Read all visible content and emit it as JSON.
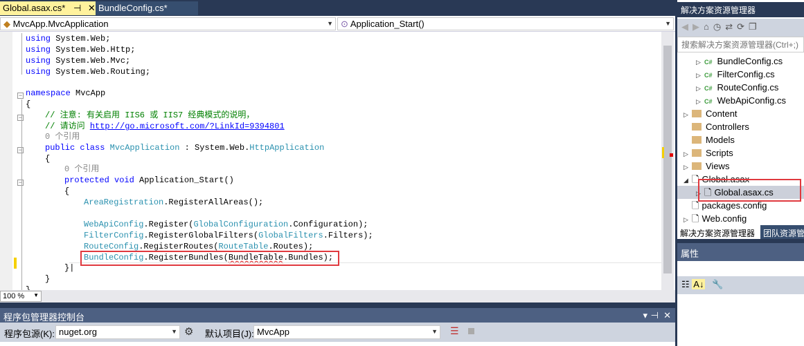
{
  "tabs": [
    {
      "label": "Global.asax.cs*",
      "active": true
    },
    {
      "label": "BundleConfig.cs*",
      "active": false
    }
  ],
  "navbar": {
    "class_combo": "MvcApp.MvcApplication",
    "member_combo": "Application_Start()"
  },
  "code": {
    "l1": "System.Web;",
    "l2": "System.Web.Http;",
    "l3": "System.Web.Mvc;",
    "l4": "System.Web.Routing;",
    "using": "using",
    "namespace_kw": "namespace",
    "namespace_name": " MvcApp",
    "brace_open": "{",
    "brace_close": "}",
    "comment1": "// 注意: 有关启用 IIS6 或 IIS7 经典模式的说明，",
    "comment2_prefix": "// 请访问 ",
    "comment2_link": "http://go.microsoft.com/?LinkId=9394801",
    "refs": "0 个引用",
    "public_class": "public class ",
    "class_name": "MvcApplication",
    "colon": " : System.Web.",
    "base": "HttpApplication",
    "protected_void": "protected void ",
    "method": "Application_Start()",
    "area_t": "AreaRegistration",
    "area_m": ".RegisterAllAreas();",
    "webapi_t": "WebApiConfig",
    "webapi_m": ".Register(",
    "gc_t": "GlobalConfiguration",
    "gc_m": ".Configuration);",
    "filter_t": "FilterConfig",
    "filter_m": ".RegisterGlobalFilters(",
    "gf_t": "GlobalFilters",
    "gf_m": ".Filters);",
    "route_t": "RouteConfig",
    "route_m": ".RegisterRoutes(",
    "rt_t": "RouteTable",
    "rt_m": ".Routes);",
    "bundle_t": "BundleConfig",
    "bundle_m": ".RegisterBundles(",
    "bt_t": "BundleTable",
    "bt_m": ".Bundles);"
  },
  "zoom": "100 %",
  "console": {
    "title": "程序包管理器控制台",
    "source_label": "程序包源(K):",
    "source_value": "nuget.org",
    "project_label": "默认项目(J):",
    "project_value": "MvcApp"
  },
  "solution_explorer": {
    "title": "解决方案资源管理器",
    "search_placeholder": "搜索解决方案资源管理器(Ctrl+;)",
    "items": [
      {
        "label": "BundleConfig.cs",
        "type": "cs"
      },
      {
        "label": "FilterConfig.cs",
        "type": "cs"
      },
      {
        "label": "RouteConfig.cs",
        "type": "cs"
      },
      {
        "label": "WebApiConfig.cs",
        "type": "cs"
      },
      {
        "label": "Content",
        "type": "folder"
      },
      {
        "label": "Controllers",
        "type": "folder"
      },
      {
        "label": "Models",
        "type": "folder"
      },
      {
        "label": "Scripts",
        "type": "folder"
      },
      {
        "label": "Views",
        "type": "folder"
      },
      {
        "label": "Global.asax",
        "type": "asax"
      },
      {
        "label": "Global.asax.cs",
        "type": "file",
        "selected": true
      },
      {
        "label": "packages.config",
        "type": "config"
      },
      {
        "label": "Web.config",
        "type": "config"
      }
    ],
    "bottom_tabs": [
      "解决方案资源管理器",
      "团队资源管理器"
    ]
  },
  "properties": {
    "title": "属性"
  },
  "colors": {
    "highlight_box": "#e0393e",
    "active_tab": "#fff29d",
    "chrome": "#293955"
  }
}
